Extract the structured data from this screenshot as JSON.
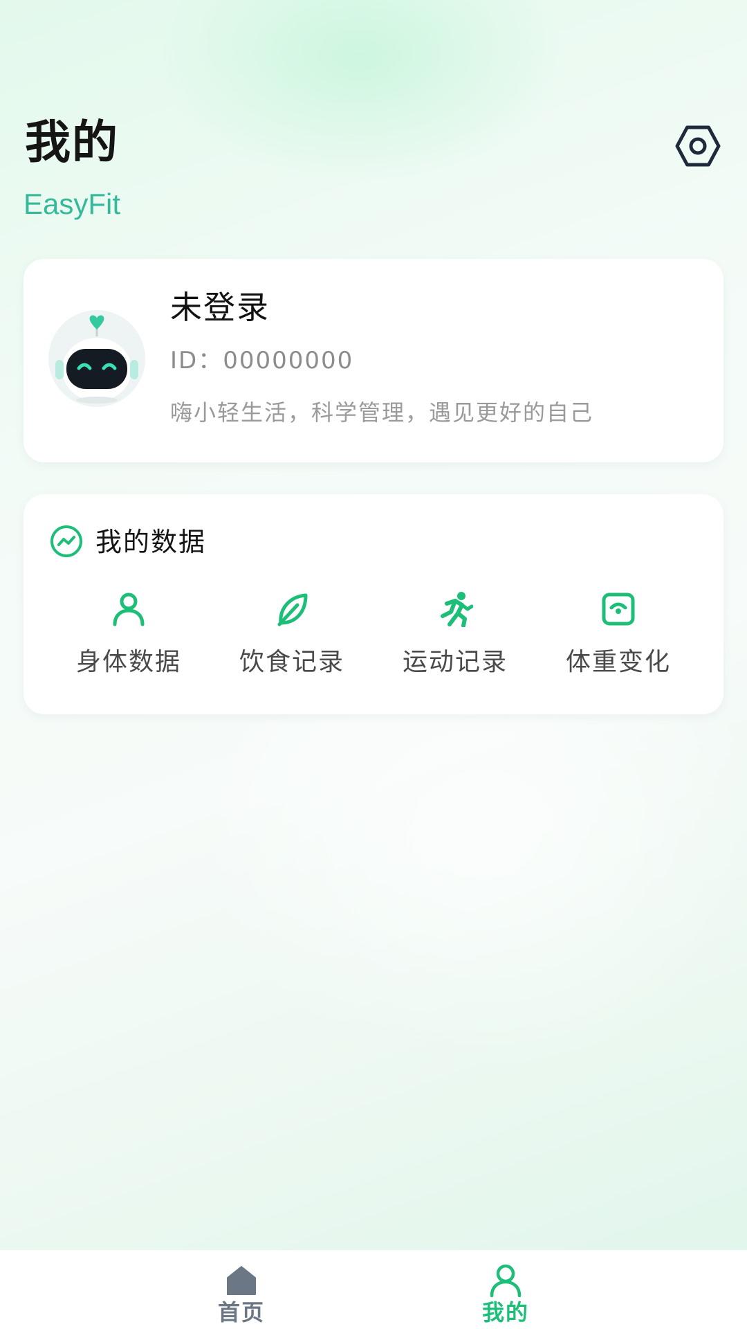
{
  "header": {
    "title": "我的",
    "subtitle": "EasyFit",
    "settings_icon": "gear-icon"
  },
  "profile": {
    "name": "未登录",
    "id_text": "ID：00000000",
    "slogan": "嗨小轻生活，科学管理，遇见更好的自己",
    "avatar_icon": "robot-avatar"
  },
  "my_data": {
    "title": "我的数据",
    "icon": "trend-chart-icon",
    "items": [
      {
        "label": "身体数据",
        "icon": "person-icon"
      },
      {
        "label": "饮食记录",
        "icon": "leaf-icon"
      },
      {
        "label": "运动记录",
        "icon": "running-icon"
      },
      {
        "label": "体重变化",
        "icon": "scale-icon"
      }
    ]
  },
  "tabbar": {
    "tabs": [
      {
        "label": "首页",
        "icon": "home-icon",
        "active": false
      },
      {
        "label": "我的",
        "icon": "user-icon",
        "active": true
      }
    ]
  },
  "colors": {
    "accent": "#1dbf78",
    "brand_text": "#36b99a",
    "inactive": "#6b7785"
  }
}
